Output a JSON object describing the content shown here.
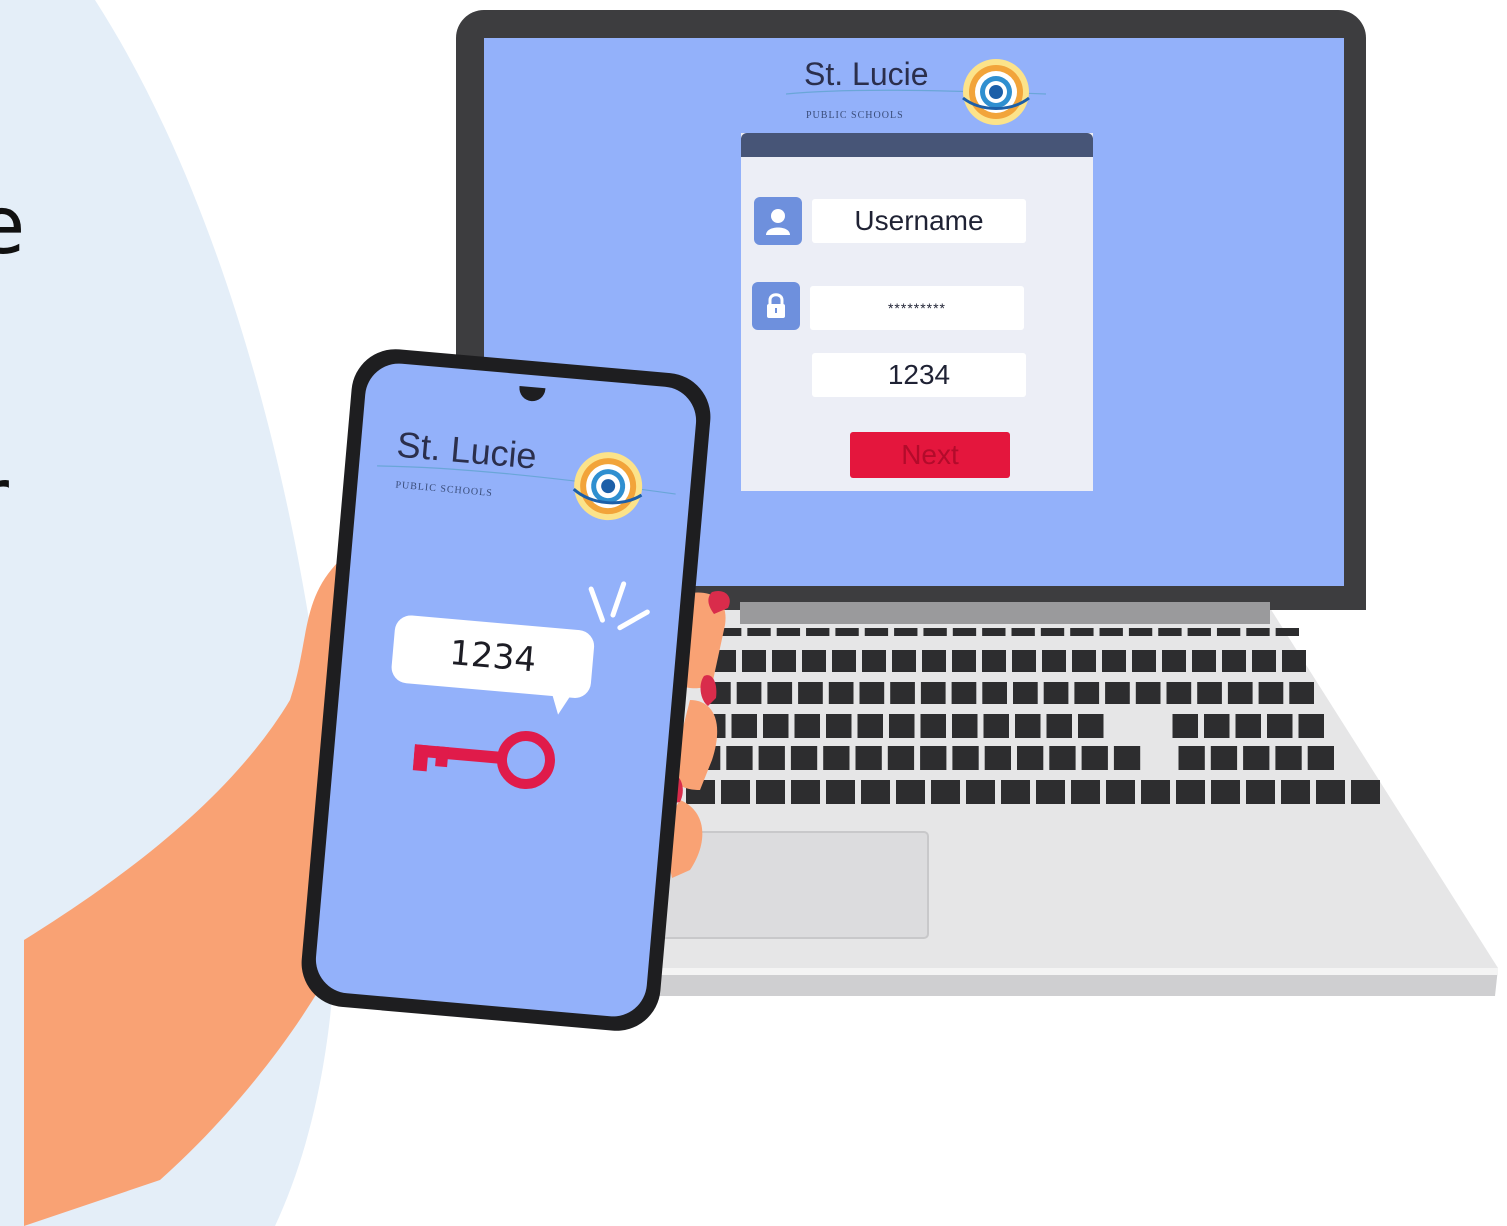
{
  "brand": {
    "name": "St. Lucie",
    "subtitle": "PUBLIC SCHOOLS"
  },
  "login_form": {
    "username_placeholder": "Username",
    "password_mask": "*********",
    "code_value": "1234",
    "next_button": "Next"
  },
  "phone": {
    "notification_code": "1234"
  },
  "clipped_text": {
    "line1_char": "e",
    "line2_char": "r"
  },
  "icons": [
    "user-icon",
    "lock-icon",
    "key-icon",
    "notification-burst-icon"
  ],
  "colors": {
    "screen": "#93b1fa",
    "panel_bar": "#475577",
    "next_button": "#e4163d",
    "key": "#e01b4a",
    "bezel": "#3d3d3f"
  }
}
